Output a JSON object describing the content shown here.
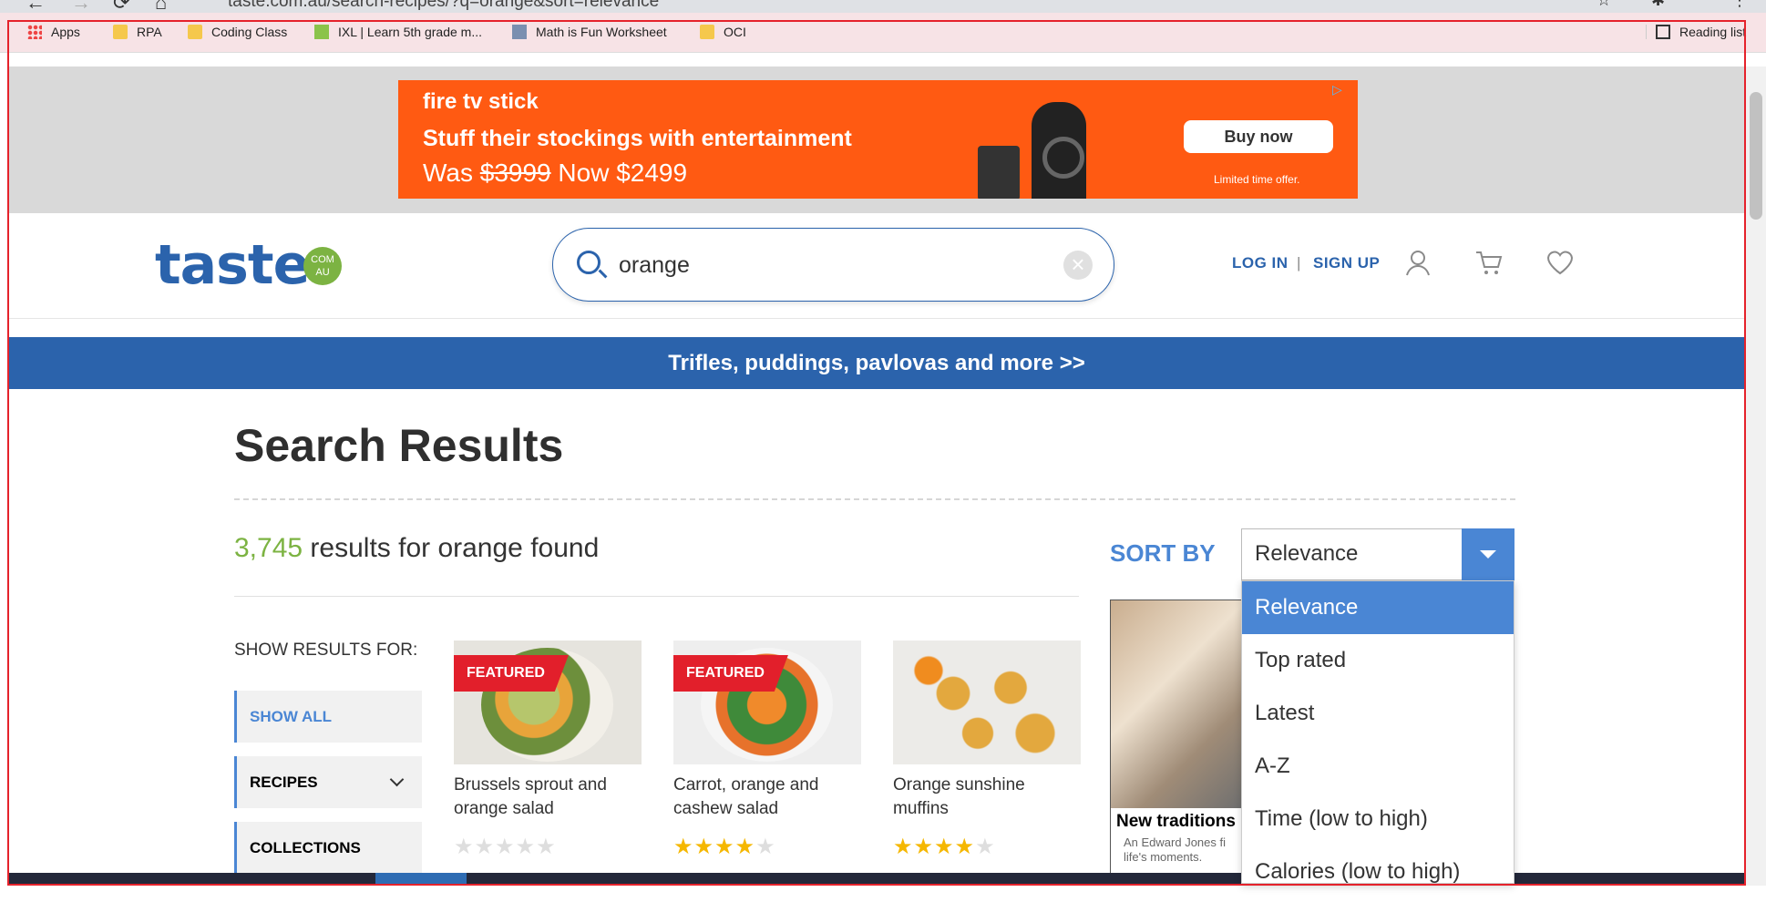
{
  "browser": {
    "url": "taste.com.au/search-recipes/?q=orange&sort=relevance",
    "bookmarks": [
      "Apps",
      "RPA",
      "Coding Class",
      "IXL | Learn 5th grade m...",
      "Math is Fun Worksheet",
      "OCI"
    ],
    "reading_list": "Reading list"
  },
  "ad": {
    "brand": "fire tv stick",
    "headline": "Stuff their stockings with entertainment",
    "price_was_prefix": "Was ",
    "price_was": "$3999",
    "price_now_prefix": " Now ",
    "price_now": "$2499",
    "cta": "Buy now",
    "note": "Limited time offer."
  },
  "header": {
    "logo": "taste",
    "logo_badge": "COM AU",
    "search_value": "orange",
    "login": "LOG IN",
    "separator": "|",
    "signup": "SIGN UP"
  },
  "promo": {
    "text": "Trifles, puddings, pavlovas and more >>"
  },
  "main": {
    "title": "Search Results",
    "result_count": "3,745",
    "result_text": " results for orange found",
    "sort_label": "SORT BY",
    "sort_selected": "Relevance",
    "sort_options": [
      "Relevance",
      "Top rated",
      "Latest",
      "A-Z",
      "Time (low to high)",
      "Calories (low to high)"
    ]
  },
  "filters": {
    "heading": "SHOW RESULTS FOR:",
    "items": [
      "SHOW ALL",
      "RECIPES",
      "COLLECTIONS"
    ]
  },
  "cards": [
    {
      "title": "Brussels sprout and orange salad",
      "featured": "FEATURED",
      "stars": 0
    },
    {
      "title": "Carrot, orange and cashew salad",
      "featured": "FEATURED",
      "stars": 4
    },
    {
      "title": "Orange sunshine muffins",
      "featured": "",
      "stars": 4
    }
  ],
  "side_ad": {
    "title": "New traditions",
    "text": "An Edward Jones fi life's moments."
  },
  "colors": {
    "brand_blue": "#2b63ac",
    "accent_blue": "#4a86d4",
    "green": "#7cb342",
    "featured_red": "#e21f2b",
    "star_gold": "#f5b700"
  }
}
